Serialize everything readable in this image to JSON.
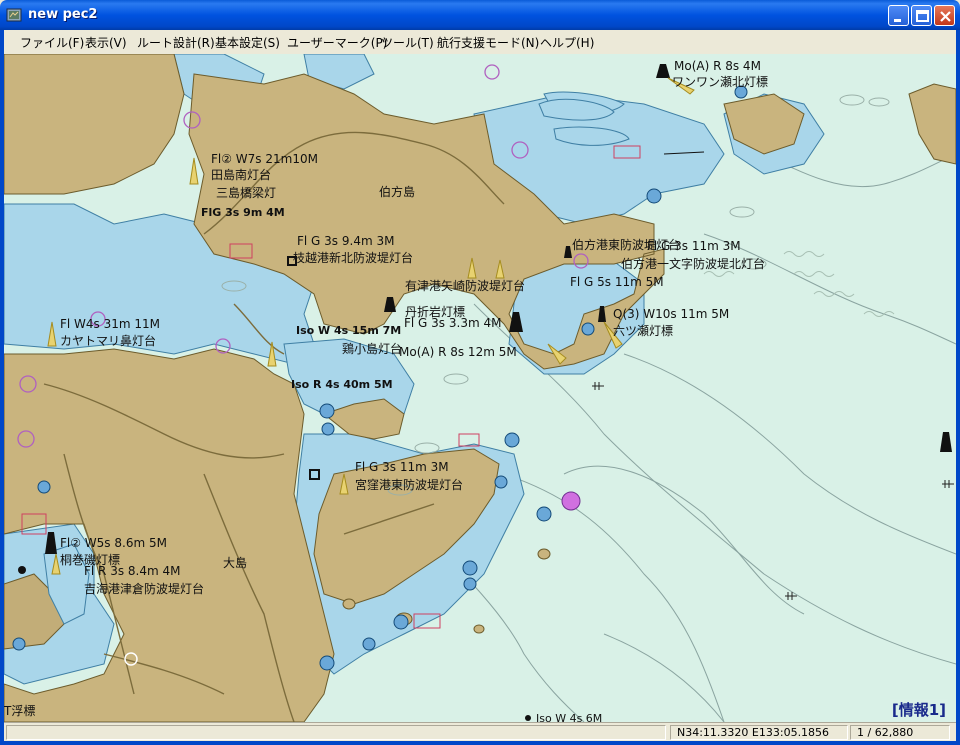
{
  "window": {
    "title": "new pec2"
  },
  "menu": [
    {
      "label": "ファイル(F)"
    },
    {
      "label": "表示(V)"
    },
    {
      "label": "ルート設計(R)"
    },
    {
      "label": "基本設定(S)"
    },
    {
      "label": "ユーザーマーク(P)"
    },
    {
      "label": "ツール(T)"
    },
    {
      "label": "航行支援モード(N)"
    },
    {
      "label": "ヘルプ(H)"
    }
  ],
  "map": {
    "labels": [
      {
        "text": "Mo(A) R 8s 4M"
      },
      {
        "text": "ワンワン瀬北灯標"
      },
      {
        "text": "Fl② W7s 21m10M"
      },
      {
        "text": "田島南灯台"
      },
      {
        "text": "三島橋梁灯"
      },
      {
        "text": "FlG 3s 9m 4M"
      },
      {
        "text": "伯方島"
      },
      {
        "text": "Fl G 3s 9.4m 3M"
      },
      {
        "text": "枝越港新北防波堤灯台"
      },
      {
        "text": "伯方港東防波堤灯台"
      },
      {
        "text": "Fl G 3s 11m 3M"
      },
      {
        "text": "伯方港一文字防波堤北灯台"
      },
      {
        "text": "Fl G 5s 11m 5M"
      },
      {
        "text": "有津港矢崎防波堤灯台"
      },
      {
        "text": "丹折岩灯標"
      },
      {
        "text": "Fl G 3s 3.3m 4M"
      },
      {
        "text": "Q(3) W10s 11m 5M"
      },
      {
        "text": "六ツ瀬灯標"
      },
      {
        "text": "Fl W4s 31m 11M"
      },
      {
        "text": "カヤトマリ鼻灯台"
      },
      {
        "text": "Iso W 4s 15m 7M"
      },
      {
        "text": "鶏小島灯台"
      },
      {
        "text": "Mo(A) R 8s 12m 5M"
      },
      {
        "text": "Iso R 4s 40m 5M"
      },
      {
        "text": "Fl G 3s 11m 3M"
      },
      {
        "text": "宮窪港東防波堤灯台"
      },
      {
        "text": "Fl② W5s 8.6m 5M"
      },
      {
        "text": "桐巻磯灯標"
      },
      {
        "text": "Fl R 3s 8.4m 4M"
      },
      {
        "text": "吉海港津倉防波堤灯台"
      },
      {
        "text": "大島"
      },
      {
        "text": "T浮標"
      },
      {
        "text": "Iso W 4s 6M"
      }
    ],
    "info_panel": "[情報1]"
  },
  "status": {
    "blank": "",
    "position": "N34:11.3320 E133:05.1856",
    "scale": "1 / 62,880"
  },
  "colors": {
    "land": "#c9b47e",
    "shallow_water": "#a9d6ea",
    "sea": "#d9f1e7",
    "titlebar": "#0053e0"
  }
}
